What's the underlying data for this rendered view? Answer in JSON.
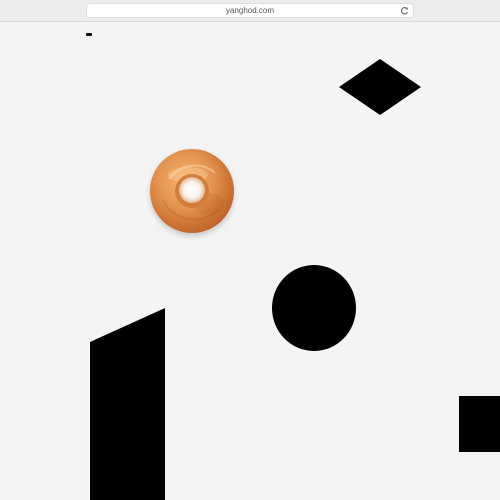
{
  "browser": {
    "address": "yanghod.com",
    "reload_icon": "reload-icon"
  },
  "page": {
    "shapes": [
      {
        "name": "logo-mark",
        "icon": "dash-icon"
      },
      {
        "name": "diamond-shape",
        "color": "#000000"
      },
      {
        "name": "donut-image",
        "colors": [
          "#e59a58",
          "#c76f2f",
          "#ffffff"
        ]
      },
      {
        "name": "circle-shape",
        "color": "#000000"
      },
      {
        "name": "slanted-slab-shape",
        "color": "#000000"
      },
      {
        "name": "edge-square-shape",
        "color": "#000000"
      }
    ]
  }
}
